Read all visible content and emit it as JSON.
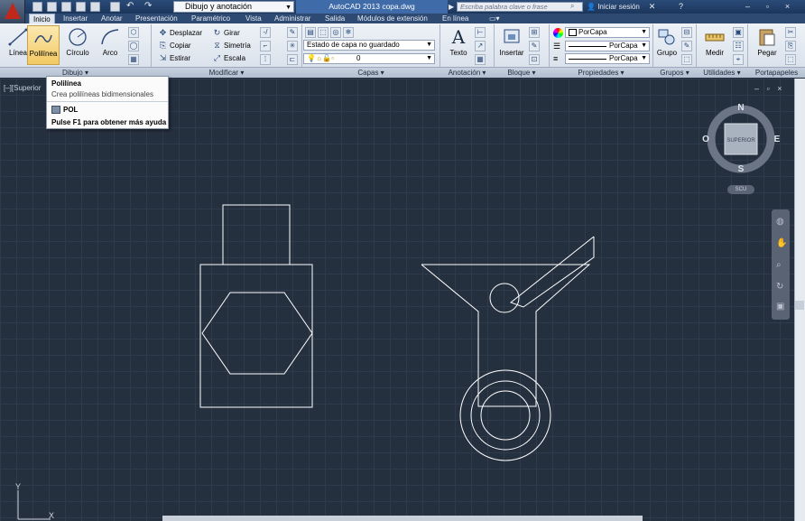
{
  "app": {
    "workspace": "Dibujo y anotación",
    "title": "AutoCAD 2013    copa.dwg",
    "search_placeholder": "Escriba palabra clave o frase",
    "login": "Iniciar sesión"
  },
  "tabs": [
    "Inicio",
    "Insertar",
    "Anotar",
    "Presentación",
    "Paramétrico",
    "Vista",
    "Administrar",
    "Salida",
    "Módulos de extensión",
    "En línea"
  ],
  "draw": {
    "linea": "Línea",
    "polilinea": "Polilínea",
    "circulo": "Círculo",
    "arco": "Arco",
    "panel": "Dibujo"
  },
  "modify": {
    "desplazar": "Desplazar",
    "girar": "Girar",
    "copiar": "Copiar",
    "simetria": "Simetría",
    "estirar": "Estirar",
    "escala": "Escala",
    "panel": "Modificar"
  },
  "layers": {
    "state": "Estado de capa no guardado",
    "current": "0",
    "panel": "Capas"
  },
  "annotation": {
    "texto": "Texto",
    "panel": "Anotación"
  },
  "block": {
    "insertar": "Insertar",
    "panel": "Bloque"
  },
  "properties": {
    "color": "PorCapa",
    "linetype": "PorCapa",
    "lineweight": "PorCapa",
    "panel": "Propiedades"
  },
  "groups": {
    "grupo": "Grupo",
    "panel": "Grupos"
  },
  "utilities": {
    "medir": "Medir",
    "panel": "Utilidades"
  },
  "clipboard": {
    "pegar": "Pegar",
    "panel": "Portapapeles"
  },
  "tooltip": {
    "title": "Polilínea",
    "desc": "Crea polilíneas bidimensionales",
    "command": "POL",
    "help": "Pulse F1 para obtener más ayuda"
  },
  "viewport": {
    "label": "[–][Superior",
    "controls": "– ▫ ×"
  },
  "viewcube": {
    "n": "N",
    "s": "S",
    "e": "E",
    "o": "O",
    "face": "SUPERIOR",
    "wcs": "SCU"
  },
  "ucs": {
    "x": "X",
    "y": "Y"
  },
  "colors": {
    "canvas": "#25303f",
    "grid": "#2f3b4c",
    "geometry": "#ffffff",
    "accent": "#f2c964"
  }
}
